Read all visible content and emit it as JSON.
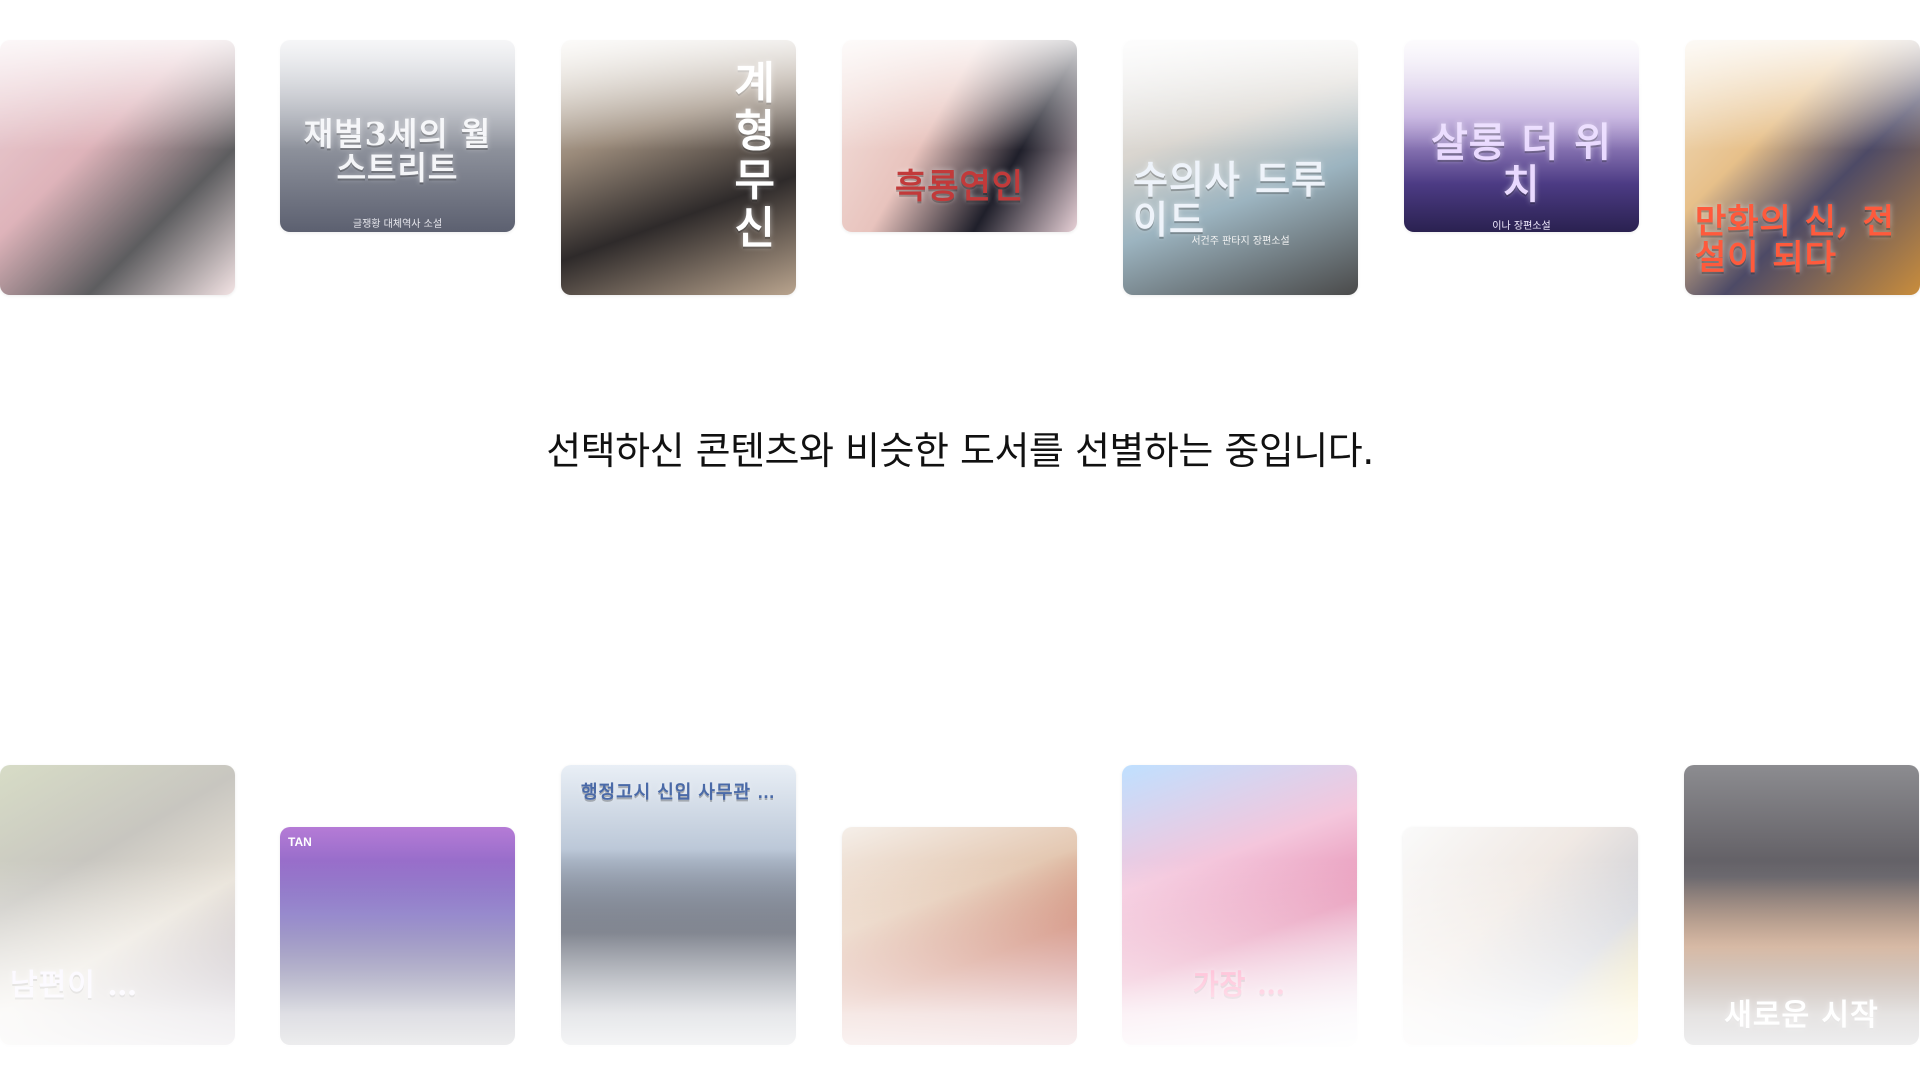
{
  "status_message": "선택하신 콘텐츠와 비슷한 도서를 선별하는 중입니다.",
  "top_covers": [
    {
      "title": "",
      "sub": ""
    },
    {
      "title": "재벌3세의 월스트리트",
      "sub": "글쟁황 대체역사 소설"
    },
    {
      "title": "계형 무신",
      "sub": ""
    },
    {
      "title": "흑룡연인",
      "sub": ""
    },
    {
      "title": "수의사 드루이드",
      "sub": "서건주 판타지 장편소설"
    },
    {
      "title": "살롱 더 위치",
      "sub": "이나 장편소설"
    },
    {
      "title": "만화의 신, 전설이 되다",
      "sub": ""
    }
  ],
  "bottom_covers": [
    {
      "title": "남편이 …",
      "sub": ""
    },
    {
      "title": "",
      "sub": "",
      "badge": "TAN"
    },
    {
      "title": "행정고시 신입 사무관 …",
      "sub": ""
    },
    {
      "title": "",
      "sub": ""
    },
    {
      "title": "가장 …",
      "sub": ""
    },
    {
      "title": "",
      "sub": ""
    },
    {
      "title": "새로운 시작",
      "sub": ""
    }
  ]
}
